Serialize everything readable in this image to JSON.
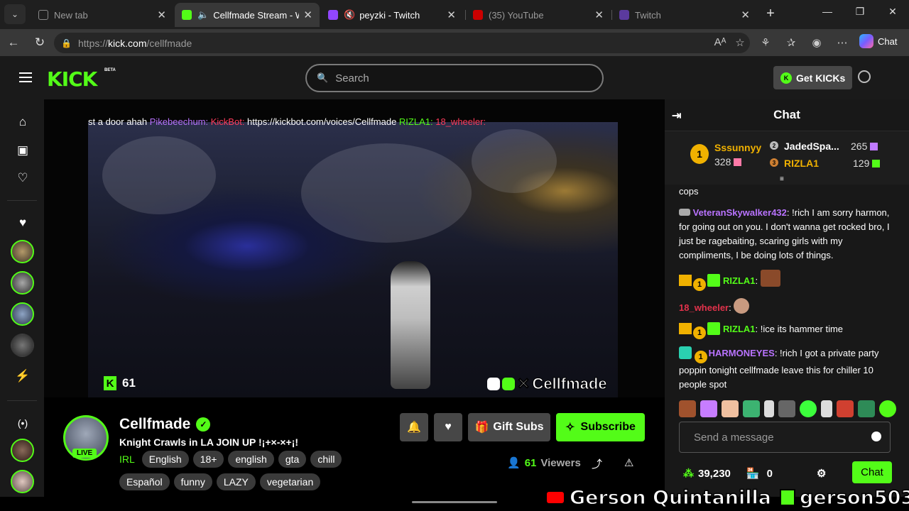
{
  "browser": {
    "tabs": [
      {
        "label": "New tab",
        "active": false
      },
      {
        "label": "Cellfmade Stream - Wa",
        "active": true
      },
      {
        "label": "peyzki - Twitch",
        "active": false
      },
      {
        "label": "(35) YouTube",
        "active": false
      },
      {
        "label": "Twitch",
        "active": false
      }
    ],
    "url_prefix": "https://",
    "url_host": "kick.com",
    "url_path": "/cellfmade",
    "chat_label": "Chat"
  },
  "header": {
    "logo": "KICK",
    "beta": "BETA",
    "search_placeholder": "Search",
    "get_kicks": "Get KICKs"
  },
  "player": {
    "ticker": {
      "t1": "st a door ahah ",
      "u1": "Pikebeechum:",
      "u2": "KickBot:",
      "t2": " https://kickbot.com/voices/Cellfmade ",
      "u3": "RIZLA1:",
      "u4": "18_wheeler:"
    },
    "viewer_count": "61",
    "watermark": "Cellfmade"
  },
  "channel": {
    "name": "Cellfmade",
    "live": "LIVE",
    "title": "Knight Crawls in LA JOIN UP !¡+×-×+¡!",
    "category": "IRL",
    "tags": [
      "English",
      "18+",
      "english",
      "gta",
      "chill",
      "Español",
      "funny",
      "LAZY",
      "vegetarian"
    ],
    "gift_subs": "Gift Subs",
    "subscribe": "Subscribe",
    "viewers_num": "61",
    "viewers_label": "Viewers"
  },
  "chat": {
    "title": "Chat",
    "leaderboard": [
      {
        "rank": "1",
        "name": "Sssunnyy",
        "count": "328"
      },
      {
        "rank": "2",
        "name": "JadedSpa...",
        "count": "265"
      },
      {
        "rank": "3",
        "name": "RIZLA1",
        "count": "129"
      }
    ],
    "messages": [
      {
        "text": "cops"
      },
      {
        "user": "VeteranSkywalker432",
        "color": "#b973ff",
        "text": "!rich I am sorry harmon, for going out on you. I don't wanna get rocked bro, I just be ragebaiting, scaring girls with my compliments, I be doing lots of things."
      },
      {
        "user": "RIZLA1",
        "color": "#53fc18",
        "text": ""
      },
      {
        "user": "18_wheeler",
        "color": "#e2324b",
        "text": ""
      },
      {
        "user": "RIZLA1",
        "color": "#53fc18",
        "text": "!ice its hammer time"
      },
      {
        "user": "HARMONEYES",
        "color": "#b973ff",
        "text": "!rich I got a private party poppin tonight cellfmade leave this for chiller 10 people spot"
      }
    ],
    "badge_num": "1",
    "input_placeholder": "Send a message",
    "points": "39,230",
    "store": "0",
    "send_label": "Chat"
  },
  "overlay": {
    "yt_name": "Gerson Quintanilla",
    "kick_name": "gerson503"
  }
}
